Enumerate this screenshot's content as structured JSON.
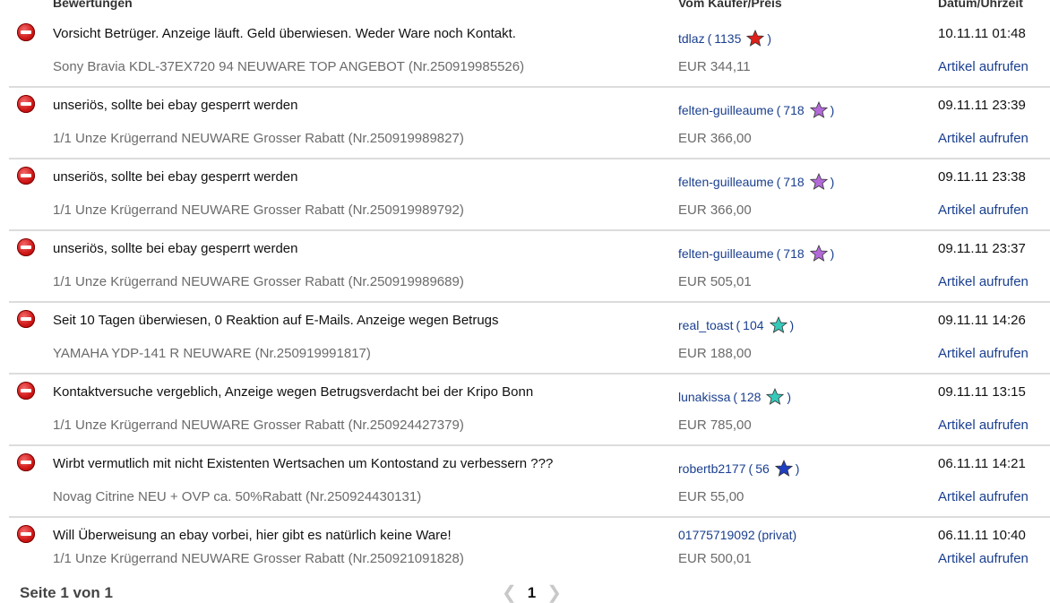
{
  "header": {
    "col_feedback": "Bewertungen",
    "col_buyer": "Vom Käufer/Preis",
    "col_date": "Datum/Uhrzeit"
  },
  "rows": [
    {
      "comment": "Vorsicht Betrüger. Anzeige läuft. Geld überwiesen. Weder Ware noch Kontakt.",
      "item": "Sony Bravia KDL-37EX720 94 NEUWARE TOP ANGEBOT (Nr.250919985526)",
      "buyer": "tdlaz",
      "score": "1135",
      "star_color": "#e0201a",
      "price": "EUR 344,11",
      "date": "10.11.11 01:48",
      "link": "Artikel aufrufen"
    },
    {
      "comment": "unseriös, sollte bei ebay gesperrt werden",
      "item": "1/1 Unze Krügerrand NEUWARE Grosser Rabatt (Nr.250919989827)",
      "buyer": "felten-guilleaume",
      "score": "718",
      "star_color": "#b36ad8",
      "price": "EUR 366,00",
      "date": "09.11.11 23:39",
      "link": "Artikel aufrufen"
    },
    {
      "comment": "unseriös, sollte bei ebay gesperrt werden",
      "item": "1/1 Unze Krügerrand NEUWARE Grosser Rabatt (Nr.250919989792)",
      "buyer": "felten-guilleaume",
      "score": "718",
      "star_color": "#b36ad8",
      "price": "EUR 366,00",
      "date": "09.11.11 23:38",
      "link": "Artikel aufrufen"
    },
    {
      "comment": "unseriös, sollte bei ebay gesperrt werden",
      "item": "1/1 Unze Krügerrand NEUWARE Grosser Rabatt (Nr.250919989689)",
      "buyer": "felten-guilleaume",
      "score": "718",
      "star_color": "#b36ad8",
      "price": "EUR 505,01",
      "date": "09.11.11 23:37",
      "link": "Artikel aufrufen"
    },
    {
      "comment": "Seit 10 Tagen überwiesen, 0 Reaktion auf E-Mails. Anzeige wegen Betrugs",
      "item": "YAMAHA YDP-141 R NEUWARE (Nr.250919991817)",
      "buyer": "real_toast",
      "score": "104",
      "star_color": "#35c9b9",
      "price": "EUR 188,00",
      "date": "09.11.11 14:26",
      "link": "Artikel aufrufen"
    },
    {
      "comment": "Kontaktversuche vergeblich, Anzeige wegen Betrugsverdacht bei der Kripo Bonn",
      "item": "1/1 Unze Krügerrand NEUWARE Grosser Rabatt (Nr.250924427379)",
      "buyer": "lunakissa",
      "score": "128",
      "star_color": "#35c9b9",
      "price": "EUR 785,00",
      "date": "09.11.11 13:15",
      "link": "Artikel aufrufen"
    },
    {
      "comment": "Wirbt vermutlich mit nicht Existenten Wertsachen um Kontostand zu verbessern ???",
      "item": "Novag Citrine NEU + OVP ca. 50%Rabatt (Nr.250924430131)",
      "buyer": "robertb2177",
      "score": "56",
      "star_color": "#1e3fc0",
      "price": "EUR 55,00",
      "date": "06.11.11 14:21",
      "link": "Artikel aufrufen"
    },
    {
      "comment": "Will Überweisung an ebay vorbei, hier gibt es natürlich keine Ware!",
      "item": "1/1 Unze Krügerrand NEUWARE Grosser Rabatt (Nr.250921091828)",
      "buyer": "01775719092",
      "private_label": "(privat)",
      "price": "EUR 500,01",
      "date": "06.11.11 10:40",
      "link": "Artikel aufrufen"
    }
  ],
  "footer": {
    "page_info": "Seite 1 von 1",
    "current_page": "1",
    "prev_icon": "chevron-left-icon",
    "next_icon": "chevron-right-icon"
  }
}
